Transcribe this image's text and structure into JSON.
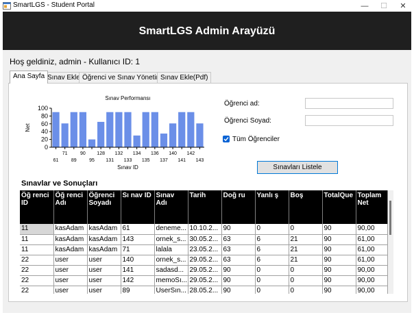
{
  "window": {
    "title": "SmartLGS - Student Portal",
    "minimize": "—",
    "maximize": "☐",
    "close": "✕"
  },
  "header": {
    "title": "SmartLGS Admin Arayüzü"
  },
  "welcome": "Hoş geldiniz, admin - Kullanıcı ID: 1",
  "tabs": [
    {
      "label": "Ana Sayfa",
      "active": true
    },
    {
      "label": "Sınav Ekle",
      "active": false
    },
    {
      "label": "Öğrenci ve Sınav Yönetimi",
      "active": false
    },
    {
      "label": "Sınav Ekle(Pdf)",
      "active": false
    }
  ],
  "form": {
    "first_name_label": "Öğrenci ad:",
    "first_name_value": "",
    "last_name_label": "Öğrenci Soyad:",
    "last_name_value": "",
    "all_students_label": "Tüm Öğrenciler",
    "all_students_checked": true,
    "list_button": "Sınavları Listele"
  },
  "colors": {
    "bar": "#6b8fe8",
    "header_bg": "#1f1f1f",
    "accent": "#0078d7"
  },
  "chart_data": {
    "type": "bar",
    "title": "Sınav Performansı",
    "xlabel": "Sınav ID",
    "ylabel": "Net",
    "ylim": [
      0,
      100
    ],
    "yticks": [
      0,
      20,
      40,
      60,
      80,
      100
    ],
    "grid": false,
    "categories": [
      "61",
      "71",
      "89",
      "90",
      "95",
      "128",
      "131",
      "132",
      "133",
      "134",
      "135",
      "136",
      "137",
      "140",
      "141",
      "142",
      "143"
    ],
    "values": [
      90,
      61,
      90,
      90,
      20,
      65,
      90,
      90,
      90,
      30,
      90,
      90,
      35,
      61,
      90,
      90,
      61
    ]
  },
  "results": {
    "title": "Sınavlar ve Sonuçları",
    "columns": [
      "Öğ renci ID",
      "Öğ renci Adı",
      "Öğrenci Soyadı",
      "Sı nav ID",
      "Sınav Adı",
      "Tarih",
      "Doğ ru",
      "Yanlı ş",
      "Boş",
      "TotalQue",
      "Toplam Net"
    ],
    "rows": [
      [
        "11",
        "kasAdam",
        "kasAdam",
        "61",
        "deneme...",
        "10.10.2...",
        "90",
        "0",
        "0",
        "90",
        "90,00"
      ],
      [
        "11",
        "kasAdam",
        "kasAdam",
        "143",
        "ornek_s...",
        "30.05.2...",
        "63",
        "6",
        "21",
        "90",
        "61,00"
      ],
      [
        "11",
        "kasAdam",
        "kasAdam",
        "71",
        "lalala",
        "23.05.2...",
        "63",
        "6",
        "21",
        "90",
        "61,00"
      ],
      [
        "22",
        "user",
        "user",
        "140",
        "ornek_s...",
        "29.05.2...",
        "63",
        "6",
        "21",
        "90",
        "61,00"
      ],
      [
        "22",
        "user",
        "user",
        "141",
        "sadasd...",
        "29.05.2...",
        "90",
        "0",
        "0",
        "90",
        "90,00"
      ],
      [
        "22",
        "user",
        "user",
        "142",
        "memoSı...",
        "29.05.2...",
        "90",
        "0",
        "0",
        "90",
        "90,00"
      ],
      [
        "22",
        "user",
        "user",
        "89",
        "UserSın...",
        "28.05.2...",
        "90",
        "0",
        "0",
        "90",
        "90,00"
      ]
    ]
  }
}
